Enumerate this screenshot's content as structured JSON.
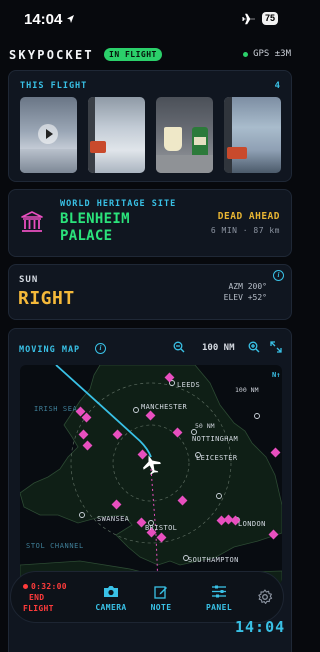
{
  "status_bar": {
    "time": "14:04",
    "battery": "75"
  },
  "header": {
    "brand": "SKYPOCKET",
    "state_pill": "IN FLIGHT",
    "gps": "GPS ±3M"
  },
  "this_flight": {
    "label": "THIS FLIGHT",
    "count": "4"
  },
  "heritage": {
    "label": "WORLD HERITAGE SITE",
    "name_line1": "BLENHEIM",
    "name_line2": "PALACE",
    "direction": "DEAD AHEAD",
    "eta": "6 MIN · 87 km"
  },
  "sun": {
    "label": "SUN",
    "direction": "RIGHT",
    "azimuth": "AZM 200°",
    "elevation": "ELEV +52°"
  },
  "map": {
    "label": "MOVING MAP",
    "zoom_value": "100 NM",
    "north": "N↑",
    "ring_outer": "100 NM",
    "ring_inner": "50 NM",
    "places": {
      "leeds": "LEEDS",
      "manchester": "MANCHESTER",
      "nottingham": "NOTTINGHAM",
      "leicester": "LEICESTER",
      "swansea": "SWANSEA",
      "bristol": "BRISTOL",
      "london": "LONDON",
      "southampton": "SOUTHAMPTON",
      "irish_sea": "IRISH SEA",
      "bristol_channel": "STOL CHANNEL"
    }
  },
  "toolbar": {
    "end_timer": "0:32:00",
    "end_label_1": "END",
    "end_label_2": "FLIGHT",
    "camera": "CAMERA",
    "note": "NOTE",
    "panel": "PANEL"
  },
  "clock": "14:04",
  "colors": {
    "accent": "#39c1e6",
    "green": "#2be37b",
    "amber": "#f4b93a",
    "danger": "#ff3b3b",
    "pink": "#e84fbf"
  }
}
